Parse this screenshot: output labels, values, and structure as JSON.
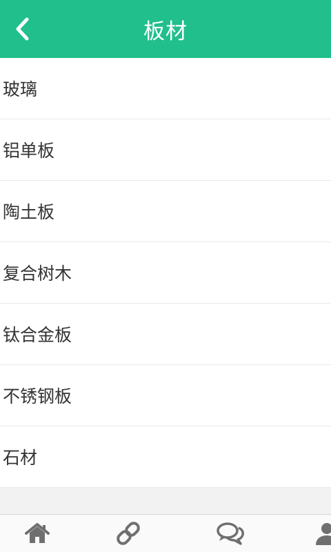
{
  "header": {
    "title": "板材",
    "back_icon": "chevron-left-icon"
  },
  "list": {
    "items": [
      {
        "label": "玻璃"
      },
      {
        "label": "铝单板"
      },
      {
        "label": "陶土板"
      },
      {
        "label": "复合树木"
      },
      {
        "label": "钛合金板"
      },
      {
        "label": "不锈钢板"
      },
      {
        "label": "石材"
      }
    ]
  },
  "tabbar": {
    "tabs": [
      {
        "icon": "home-icon"
      },
      {
        "icon": "link-icon"
      },
      {
        "icon": "chat-icon"
      },
      {
        "icon": "user-icon"
      }
    ]
  },
  "colors": {
    "accent": "#20bf8c",
    "icon_gray": "#6f6f6f",
    "text": "#333333"
  }
}
